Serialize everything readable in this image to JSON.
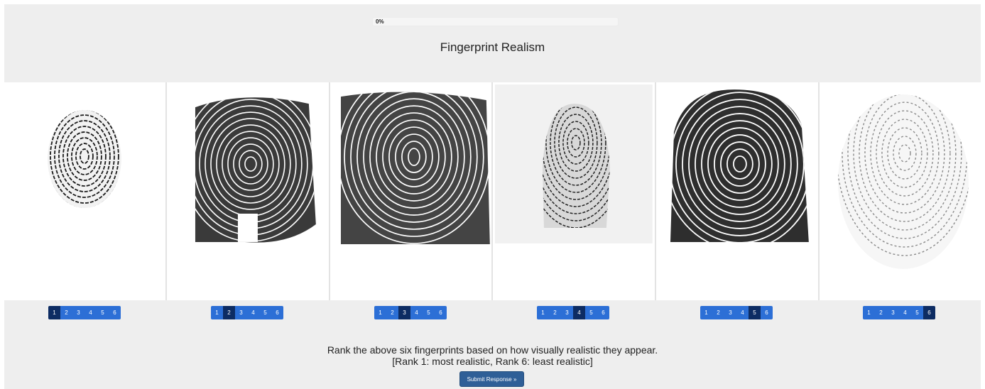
{
  "header": {
    "progress_label": "0%",
    "progress_value": 0,
    "title": "Fingerprint Realism"
  },
  "images": [
    {
      "name": "fingerprint-1"
    },
    {
      "name": "fingerprint-2"
    },
    {
      "name": "fingerprint-3"
    },
    {
      "name": "fingerprint-4"
    },
    {
      "name": "fingerprint-5"
    },
    {
      "name": "fingerprint-6"
    }
  ],
  "rank_options": [
    "1",
    "2",
    "3",
    "4",
    "5",
    "6"
  ],
  "selected_ranks": [
    1,
    2,
    3,
    4,
    5,
    6
  ],
  "footer": {
    "instruction_line1": "Rank the above six fingerprints based on how visually realistic they appear.",
    "instruction_line2": "[Rank 1: most realistic, Rank 6: least realistic]",
    "submit_label": "Submit Response »"
  },
  "colors": {
    "button_blue": "#2c6fd6",
    "button_active": "#0d2c63",
    "submit_blue": "#2f5f97",
    "band_gray": "#eeeeee"
  }
}
